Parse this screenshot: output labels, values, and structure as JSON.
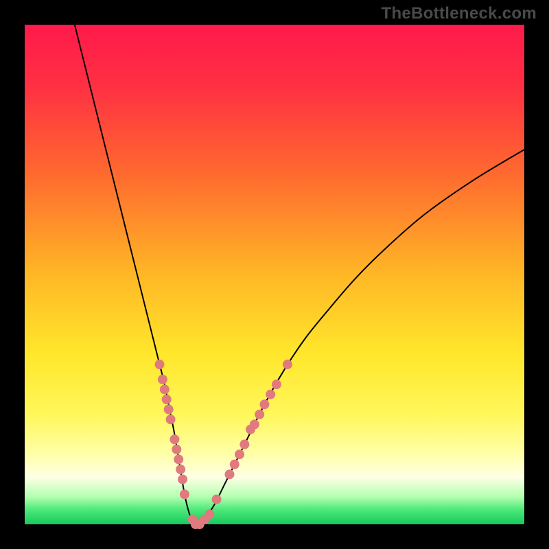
{
  "watermark": "TheBottleneck.com",
  "colors": {
    "frame": "#000000",
    "gradient_stops": [
      {
        "offset": 0.0,
        "color": "#ff1a4b"
      },
      {
        "offset": 0.12,
        "color": "#ff2f43"
      },
      {
        "offset": 0.3,
        "color": "#ff6a2f"
      },
      {
        "offset": 0.5,
        "color": "#ffb726"
      },
      {
        "offset": 0.66,
        "color": "#ffe72b"
      },
      {
        "offset": 0.78,
        "color": "#fff75a"
      },
      {
        "offset": 0.86,
        "color": "#ffffa8"
      },
      {
        "offset": 0.905,
        "color": "#ffffe6"
      },
      {
        "offset": 0.945,
        "color": "#b3ffb0"
      },
      {
        "offset": 0.97,
        "color": "#4eea7a"
      },
      {
        "offset": 1.0,
        "color": "#17c95e"
      }
    ],
    "curve": "#000000",
    "dot": "#e17a7e"
  },
  "chart_data": {
    "type": "line",
    "title": "",
    "xlabel": "",
    "ylabel": "",
    "xlim": [
      0,
      100
    ],
    "ylim": [
      0,
      100
    ],
    "grid": false,
    "legend": false,
    "series": [
      {
        "name": "bottleneck-curve",
        "x": [
          10,
          12,
          14,
          16,
          18,
          20,
          22,
          24,
          26,
          27,
          28,
          29,
          30,
          31,
          32,
          33,
          34,
          35,
          36,
          38,
          40,
          44,
          48,
          52,
          56,
          60,
          66,
          72,
          80,
          90,
          100
        ],
        "y": [
          100,
          92,
          84,
          76,
          68,
          60,
          52,
          44,
          36,
          32,
          28,
          23,
          18,
          12,
          6,
          2,
          0,
          0,
          1,
          4,
          8,
          16,
          24,
          31,
          37,
          42,
          49,
          55,
          62,
          69,
          75
        ]
      }
    ],
    "scatter": {
      "name": "highlight-dots",
      "points": [
        {
          "x": 27.0,
          "y": 32
        },
        {
          "x": 27.6,
          "y": 29
        },
        {
          "x": 28.0,
          "y": 27
        },
        {
          "x": 28.4,
          "y": 25
        },
        {
          "x": 28.8,
          "y": 23
        },
        {
          "x": 29.2,
          "y": 21
        },
        {
          "x": 30.0,
          "y": 17
        },
        {
          "x": 30.4,
          "y": 15
        },
        {
          "x": 30.8,
          "y": 13
        },
        {
          "x": 31.2,
          "y": 11
        },
        {
          "x": 31.6,
          "y": 9
        },
        {
          "x": 32.0,
          "y": 6
        },
        {
          "x": 33.6,
          "y": 1
        },
        {
          "x": 34.2,
          "y": 0
        },
        {
          "x": 35.0,
          "y": 0
        },
        {
          "x": 36.0,
          "y": 1
        },
        {
          "x": 37.0,
          "y": 2
        },
        {
          "x": 38.4,
          "y": 5
        },
        {
          "x": 41.0,
          "y": 10
        },
        {
          "x": 42.0,
          "y": 12
        },
        {
          "x": 43.0,
          "y": 14
        },
        {
          "x": 44.0,
          "y": 16
        },
        {
          "x": 45.2,
          "y": 19
        },
        {
          "x": 46.0,
          "y": 20
        },
        {
          "x": 47.0,
          "y": 22
        },
        {
          "x": 48.0,
          "y": 24
        },
        {
          "x": 49.2,
          "y": 26
        },
        {
          "x": 50.4,
          "y": 28
        },
        {
          "x": 52.6,
          "y": 32
        }
      ],
      "radius": 7
    }
  }
}
